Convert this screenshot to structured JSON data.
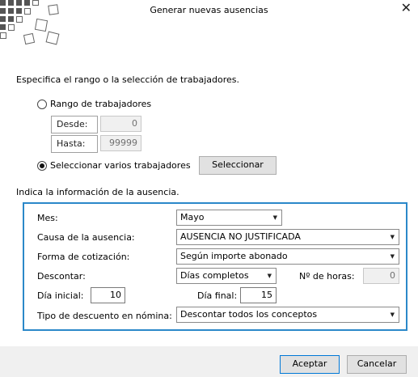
{
  "window": {
    "title": "Generar nuevas ausencias",
    "close_glyph": "✕"
  },
  "range_section": {
    "heading": "Especifica el rango o la selección de trabajadores.",
    "range_option_label": "Rango de trabajadores",
    "range_option_selected": false,
    "desde_label": "Desde:",
    "desde_value": "0",
    "hasta_label": "Hasta:",
    "hasta_value": "99999",
    "multi_option_label": "Seleccionar varios trabajadores",
    "multi_option_selected": true,
    "select_button_label": "Seleccionar"
  },
  "absence_section": {
    "heading": "Indica la información de la ausencia.",
    "mes_label": "Mes:",
    "mes_value": "Mayo",
    "causa_label": "Causa de la ausencia:",
    "causa_value": "AUSENCIA NO JUSTIFICADA",
    "forma_label": "Forma de cotización:",
    "forma_value": "Según importe abonado",
    "descontar_label": "Descontar:",
    "descontar_value": "Días completos",
    "horas_label": "Nº de horas:",
    "horas_value": "0",
    "dia_inicial_label": "Día inicial:",
    "dia_inicial_value": "10",
    "dia_final_label": "Día final:",
    "dia_final_value": "15",
    "tipo_label": "Tipo de descuento en nómina:",
    "tipo_value": "Descontar todos los conceptos"
  },
  "footer": {
    "accept_label": "Aceptar",
    "cancel_label": "Cancelar"
  },
  "icons": {
    "dropdown_arrow": "▼"
  },
  "colors": {
    "accent": "#2b88c9",
    "primary_border": "#0078d7"
  }
}
